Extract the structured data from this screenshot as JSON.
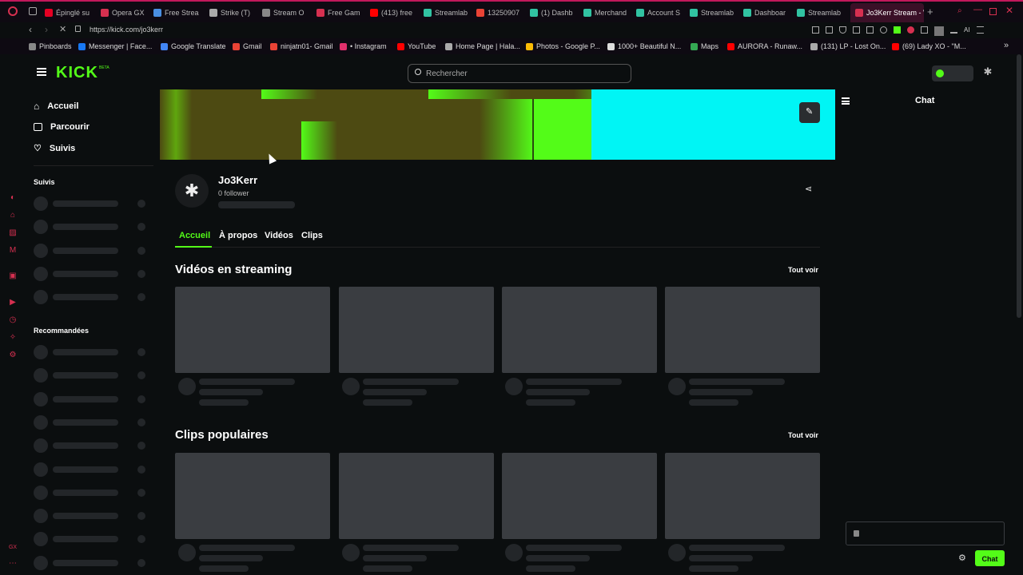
{
  "browser": {
    "tabs": [
      {
        "label": "Épinglé su",
        "color": "#e60023"
      },
      {
        "label": "Opera GX",
        "color": "#d63050"
      },
      {
        "label": "Free Strea",
        "color": "#4a90e2"
      },
      {
        "label": "Strike (T)",
        "color": "#aaaaaa"
      },
      {
        "label": "Stream O",
        "color": "#888888"
      },
      {
        "label": "Free Gam",
        "color": "#d63050"
      },
      {
        "label": "(413) free",
        "color": "#ff0000"
      },
      {
        "label": "Streamlab",
        "color": "#31c3a2"
      },
      {
        "label": "13250907",
        "color": "#ea4335"
      },
      {
        "label": "(1) Dashb",
        "color": "#31c3a2"
      },
      {
        "label": "Merchand",
        "color": "#31c3a2"
      },
      {
        "label": "Account S",
        "color": "#31c3a2"
      },
      {
        "label": "Streamlab",
        "color": "#31c3a2"
      },
      {
        "label": "Dashboar",
        "color": "#31c3a2"
      },
      {
        "label": "Streamlab",
        "color": "#31c3a2"
      },
      {
        "label": "Jo3Kerr Stream - V",
        "color": "#d63050"
      }
    ],
    "url": "https://kick.com/jo3kerr",
    "bookmarks": [
      {
        "label": "Pinboards",
        "color": "#888888"
      },
      {
        "label": "Messenger | Face...",
        "color": "#1877f2"
      },
      {
        "label": "Google Translate",
        "color": "#4285f4"
      },
      {
        "label": "Gmail",
        "color": "#ea4335"
      },
      {
        "label": "ninjatn01- Gmail",
        "color": "#ea4335"
      },
      {
        "label": "• Instagram",
        "color": "#e1306c"
      },
      {
        "label": "YouTube",
        "color": "#ff0000"
      },
      {
        "label": "Home Page | Hala...",
        "color": "#aaaaaa"
      },
      {
        "label": "Photos - Google P...",
        "color": "#fbbc05"
      },
      {
        "label": "1000+ Beautiful N...",
        "color": "#dddddd"
      },
      {
        "label": "Maps",
        "color": "#34a853"
      },
      {
        "label": "AURORA - Runaw...",
        "color": "#ff0000"
      },
      {
        "label": "(131) LP - Lost On...",
        "color": "#aaaaaa"
      },
      {
        "label": "(69) Lady XO - \"M...",
        "color": "#ff0000"
      }
    ]
  },
  "header": {
    "logo": "KICK",
    "logo_badge": "BETA",
    "search_placeholder": "Rechercher"
  },
  "sidebar": {
    "nav": [
      {
        "label": "Accueil",
        "icon": "home-icon"
      },
      {
        "label": "Parcourir",
        "icon": "browse-icon"
      },
      {
        "label": "Suivis",
        "icon": "heart-icon"
      }
    ],
    "followed_heading": "Suivis",
    "recommended_heading": "Recommandées"
  },
  "channel": {
    "name": "Jo3Kerr",
    "followers": "0 follower",
    "tabs": [
      "Accueil",
      "À propos",
      "Vidéos",
      "Clips"
    ],
    "active_tab": "Accueil",
    "section_videos": "Vidéos en streaming",
    "section_clips": "Clips populaires",
    "see_all": "Tout voir"
  },
  "chat": {
    "title": "Chat",
    "send_button": "Chat"
  },
  "colors": {
    "accent": "#53fc18",
    "banner_cyan": "#00f5f5",
    "banner_olive": "#4d4a12"
  }
}
